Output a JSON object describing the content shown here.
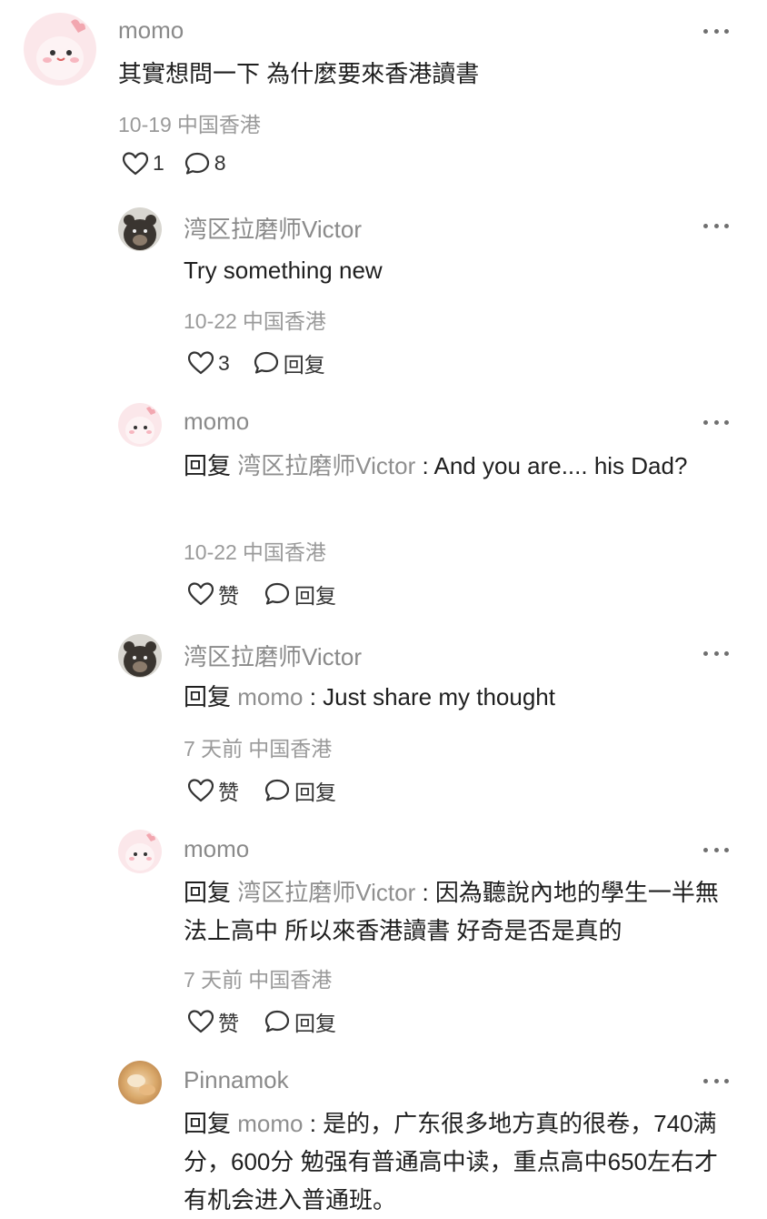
{
  "colors": {
    "username": "#8a8a8a",
    "text": "#1f1f1f",
    "meta": "#9a9a9a",
    "reply_target": "#8f8f8f"
  },
  "comments": [
    {
      "username": "momo",
      "avatar": "pink-dino-avatar",
      "text": "其實想問一下 為什麼要來香港讀書",
      "date": "10-19",
      "location": "中国香港",
      "like_label": "1",
      "reply_label": "8"
    },
    {
      "username": "湾区拉磨师Victor",
      "avatar": "bear-avatar",
      "text": "Try something new",
      "date": "10-22",
      "location": "中国香港",
      "like_label": "3",
      "reply_label": "回复"
    },
    {
      "username": "momo",
      "avatar": "pink-dino-avatar",
      "reply_prefix": "回复",
      "reply_target": "湾区拉磨师Victor",
      "reply_sep": " : ",
      "text": "And you are.... his Dad?",
      "date": "10-22",
      "location": "中国香港",
      "like_label": "赞",
      "reply_label": "回复"
    },
    {
      "username": "湾区拉磨师Victor",
      "avatar": "bear-avatar",
      "reply_prefix": "回复",
      "reply_target": "momo",
      "reply_sep": " : ",
      "text": "Just share my thought",
      "date": "7 天前",
      "location": "中国香港",
      "like_label": "赞",
      "reply_label": "回复"
    },
    {
      "username": "momo",
      "avatar": "pink-dino-avatar",
      "reply_prefix": "回复",
      "reply_target": "湾区拉磨师Victor",
      "reply_sep": " : ",
      "text": "因為聽說內地的學生一半無法上高中 所以來香港讀書 好奇是否是真的",
      "date": "7 天前",
      "location": "中国香港",
      "like_label": "赞",
      "reply_label": "回复"
    },
    {
      "username": "Pinnamok",
      "avatar": "food-photo-avatar",
      "reply_prefix": "回复",
      "reply_target": "momo",
      "reply_sep": " : ",
      "text": "是的，广东很多地方真的很卷，740满分，600分 勉强有普通高中读，重点高中650左右才有机会进入普通班。"
    }
  ]
}
